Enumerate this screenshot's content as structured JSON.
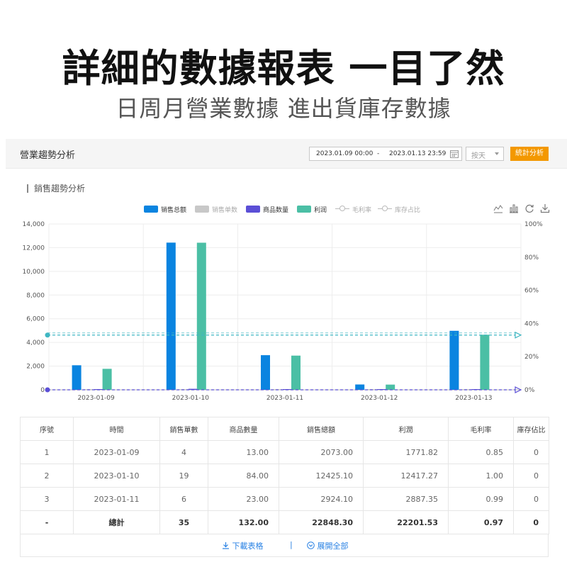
{
  "hero": {
    "title": "詳細的數據報表 一目了然",
    "subtitle": "日周月營業數據 進出貨庫存數據"
  },
  "header": {
    "title": "營業趨勢分析",
    "date_start": "2023.01.09 00:00",
    "date_sep": "-",
    "date_end": "2023.01.13 23:59",
    "granularity": "按天",
    "stats_button": "統計分析"
  },
  "section_title": "銷售趨勢分析",
  "legend": [
    {
      "label": "销售总额",
      "kind": "bar",
      "color": "#0a84e0"
    },
    {
      "label": "销售单数",
      "kind": "bar",
      "color": "#c8c8c8"
    },
    {
      "label": "商品数量",
      "kind": "bar",
      "color": "#5b4fd6"
    },
    {
      "label": "利润",
      "kind": "bar",
      "color": "#4bbfa5"
    },
    {
      "label": "毛利率",
      "kind": "line",
      "color": "#bbbbbb"
    },
    {
      "label": "库存占比",
      "kind": "line",
      "color": "#bbbbbb"
    }
  ],
  "toolbox": [
    "line-chart-icon",
    "bar-chart-icon",
    "refresh-icon",
    "download-icon"
  ],
  "chart_data": {
    "type": "bar",
    "categories": [
      "2023-01-09",
      "2023-01-10",
      "2023-01-11",
      "2023-01-12",
      "2023-01-13"
    ],
    "ylim": [
      0,
      14000
    ],
    "y_ticks": [
      "0",
      "2,000",
      "4,000",
      "6,000",
      "8,000",
      "10,000",
      "12,000",
      "14,000"
    ],
    "y2lim": [
      0,
      100
    ],
    "y2_ticks": [
      "0%",
      "20%",
      "40%",
      "60%",
      "80%",
      "100%"
    ],
    "series": [
      {
        "name": "销售总额",
        "color": "#0a84e0",
        "values": [
          2073,
          12425.1,
          2924.1,
          450,
          4980
        ]
      },
      {
        "name": "销售单数",
        "color": "#c8c8c8",
        "values": [
          4,
          19,
          6,
          1,
          5
        ]
      },
      {
        "name": "商品数量",
        "color": "#5b4fd6",
        "values": [
          13,
          84,
          23,
          5,
          10
        ]
      },
      {
        "name": "利润",
        "color": "#4bbfa5",
        "values": [
          1771.82,
          12417.27,
          2887.35,
          440,
          4650
        ]
      }
    ],
    "lines": [
      {
        "name": "毛利率",
        "color": "#3fb6c2",
        "values": [
          33,
          33,
          33,
          33,
          33
        ]
      },
      {
        "name": "库存占比",
        "color": "#5b4fd6",
        "values": [
          0,
          0,
          0,
          0,
          0
        ]
      }
    ]
  },
  "table": {
    "headers": [
      "序號",
      "時間",
      "銷售單數",
      "商品數量",
      "銷售總額",
      "利潤",
      "毛利率",
      "庫存佔比"
    ],
    "rows": [
      [
        "1",
        "2023-01-09",
        "4",
        "13.00",
        "2073.00",
        "1771.82",
        "0.85",
        "0"
      ],
      [
        "2",
        "2023-01-10",
        "19",
        "84.00",
        "12425.10",
        "12417.27",
        "1.00",
        "0"
      ],
      [
        "3",
        "2023-01-11",
        "6",
        "23.00",
        "2924.10",
        "2887.35",
        "0.99",
        "0"
      ]
    ],
    "total": [
      "-",
      "總計",
      "35",
      "132.00",
      "22848.30",
      "22201.53",
      "0.97",
      "0"
    ]
  },
  "footer": {
    "download": "下載表格",
    "separator": "|",
    "expand": "展開全部",
    "link_color": "#2a82e4"
  }
}
